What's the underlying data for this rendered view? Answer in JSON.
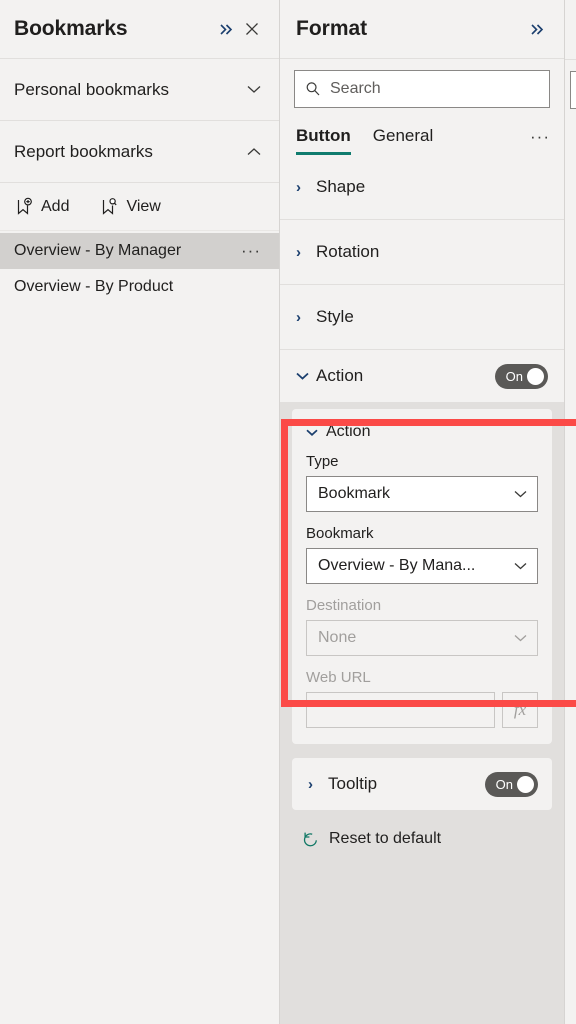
{
  "bookmarks_pane": {
    "title": "Bookmarks",
    "expand_icon": "double-chevron-right-icon",
    "close_icon": "close-icon",
    "sections": [
      {
        "label": "Personal bookmarks",
        "chevron": "chevron-down-icon",
        "expanded": false
      },
      {
        "label": "Report bookmarks",
        "chevron": "chevron-up-icon",
        "expanded": true
      }
    ],
    "actions": [
      {
        "label": "Add",
        "icon": "bookmark-add-icon"
      },
      {
        "label": "View",
        "icon": "bookmark-view-icon"
      }
    ],
    "items": [
      {
        "label": "Overview - By Manager",
        "selected": true,
        "more": "···"
      },
      {
        "label": "Overview - By Product",
        "selected": false,
        "more": ""
      }
    ]
  },
  "format_pane": {
    "title": "Format",
    "expand_icon": "double-chevron-right-icon",
    "search": {
      "placeholder": "Search",
      "value": "",
      "icon": "search-icon"
    },
    "tabs": [
      {
        "label": "Button",
        "active": true
      },
      {
        "label": "General",
        "active": false
      }
    ],
    "tabs_overflow": "···",
    "accordions": [
      {
        "label": "Shape",
        "chevron": "›",
        "expanded": false
      },
      {
        "label": "Rotation",
        "chevron": "›",
        "expanded": false
      },
      {
        "label": "Style",
        "chevron": "›",
        "expanded": false
      }
    ],
    "action_section": {
      "label": "Action",
      "chevron": "⌄",
      "toggle": {
        "label": "On",
        "state": true
      },
      "card": {
        "title": "Action",
        "chevron": "⌄",
        "fields": [
          {
            "label": "Type",
            "value": "Bookmark",
            "disabled": false
          },
          {
            "label": "Bookmark",
            "value": "Overview - By Mana...",
            "disabled": false
          },
          {
            "label": "Destination",
            "value": "None",
            "disabled": true
          }
        ],
        "web_url": {
          "label": "Web URL",
          "value": "",
          "fx_label": "fx",
          "disabled": true
        }
      }
    },
    "tooltip_section": {
      "label": "Tooltip",
      "chevron": "›",
      "toggle": {
        "label": "On",
        "state": true
      }
    },
    "reset": {
      "label": "Reset to default",
      "icon": "reset-arrow-icon"
    }
  },
  "annotation": {
    "highlight_color": "#fb4a47",
    "target": "Action"
  },
  "colors": {
    "panel_bg": "#f3f2f1",
    "format_body_bg": "#e1dfdd",
    "selected_row": "#d2d0ce",
    "accent_tab": "#107c6e",
    "toggle_on": "#5a5957",
    "reset_icon": "#117865",
    "disabled_text": "#a19f9d"
  }
}
